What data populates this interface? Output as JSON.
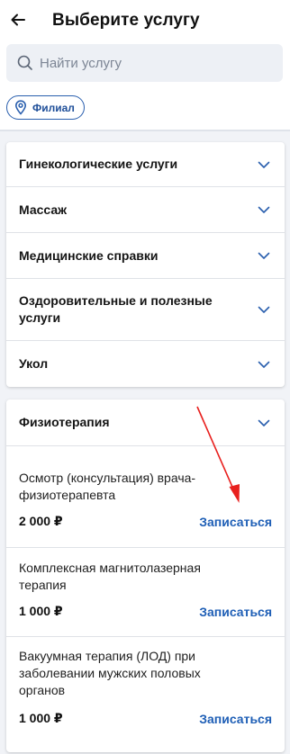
{
  "header": {
    "title": "Выберите услугу",
    "back_icon": "arrow-left-icon"
  },
  "search": {
    "placeholder": "Найти услугу",
    "icon": "search-icon"
  },
  "filter_chip": {
    "label": "Филиал",
    "icon": "location-pin-icon"
  },
  "categories": [
    {
      "label": "Гинекологические услуги"
    },
    {
      "label": "Массаж"
    },
    {
      "label": "Медицинские справки"
    },
    {
      "label": "Оздоровительные и полезные услуги"
    },
    {
      "label": "Укол"
    }
  ],
  "expanded_category": {
    "label": "Физиотерапия",
    "services": [
      {
        "name": "Осмотр (консультация) врача-физиотерапевта",
        "price": "2 000 ₽",
        "action": "Записаться"
      },
      {
        "name": "Комплексная магнитолазерная терапия",
        "price": "1 000 ₽",
        "action": "Записаться"
      },
      {
        "name": "Вакуумная терапия (ЛОД) при заболевании мужских половых органов",
        "price": "1 000 ₽",
        "action": "Записаться"
      }
    ]
  },
  "colors": {
    "accent": "#1f5fb6",
    "annotation_arrow": "#e8201e",
    "background": "#f1f3f7"
  }
}
